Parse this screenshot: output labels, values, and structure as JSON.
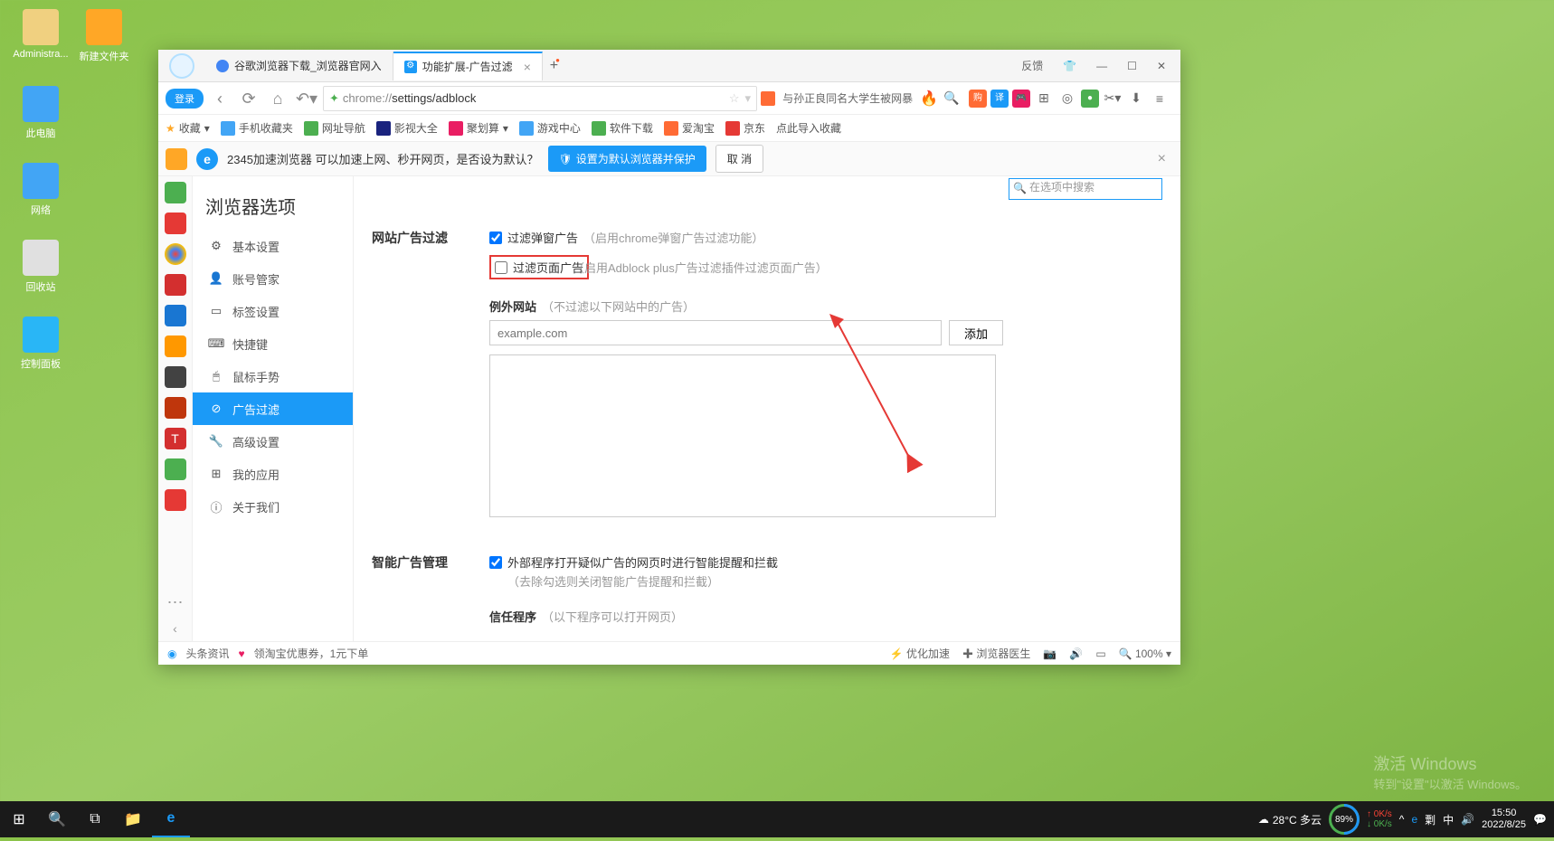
{
  "desktop": {
    "admin": "Administra...",
    "newfolder": "新建文件夹",
    "pc": "此电脑",
    "network": "网络",
    "recycle": "回收站",
    "panel": "控制面板"
  },
  "browser": {
    "tabs": [
      {
        "label": "谷歌浏览器下载_浏览器官网入"
      },
      {
        "label": "功能扩展-广告过滤"
      }
    ],
    "window_controls": {
      "feedback": "反馈"
    },
    "login_label": "登录",
    "address_prefix": "chrome://",
    "address_path": "settings/adblock",
    "hot_search": "与孙正良同名大学生被网暴",
    "bookmarks": {
      "fav": "收藏",
      "items": [
        "手机收藏夹",
        "网址导航",
        "影视大全",
        "聚划算",
        "游戏中心",
        "软件下载",
        "爱淘宝",
        "京东",
        "点此导入收藏"
      ]
    },
    "notification": {
      "text": "2345加速浏览器 可以加速上网、秒开网页，是否设为默认？",
      "primary_btn": "设置为默认浏览器并保护",
      "cancel_btn": "取 消"
    },
    "settings": {
      "title": "浏览器选项",
      "search_placeholder": "在选项中搜索",
      "menu": [
        "基本设置",
        "账号管家",
        "标签设置",
        "快捷键",
        "鼠标手势",
        "广告过滤",
        "高级设置",
        "我的应用",
        "关于我们"
      ]
    },
    "adblock": {
      "section1_label": "网站广告过滤",
      "popup_label": "过滤弹窗广告",
      "popup_hint": "（启用chrome弹窗广告过滤功能）",
      "page_label": "过滤页面广告",
      "page_hint": "（启用Adblock plus广告过滤插件过滤页面广告）",
      "exception_label": "例外网站",
      "exception_hint": "（不过滤以下网站中的广告）",
      "domain_placeholder": "example.com",
      "add_label": "添加",
      "section2_label": "智能广告管理",
      "smart_label": "外部程序打开疑似广告的网页时进行智能提醒和拦截",
      "smart_hint": "（去除勾选则关闭智能广告提醒和拦截）",
      "trust_label": "信任程序",
      "trust_hint": "（以下程序可以打开网页）"
    },
    "status_bar": {
      "news": "头条资讯",
      "coupon": "领淘宝优惠券，1元下单",
      "optimize": "优化加速",
      "doctor": "浏览器医生",
      "zoom": "100%"
    }
  },
  "taskbar": {
    "weather": "28°C 多云",
    "speed": "89%",
    "net_up": "0K/s",
    "net_down": "0K/s",
    "time": "15:50",
    "date": "2022/8/25"
  },
  "watermark": {
    "line1": "激活 Windows",
    "line2": "转到\"设置\"以激活 Windows。"
  }
}
